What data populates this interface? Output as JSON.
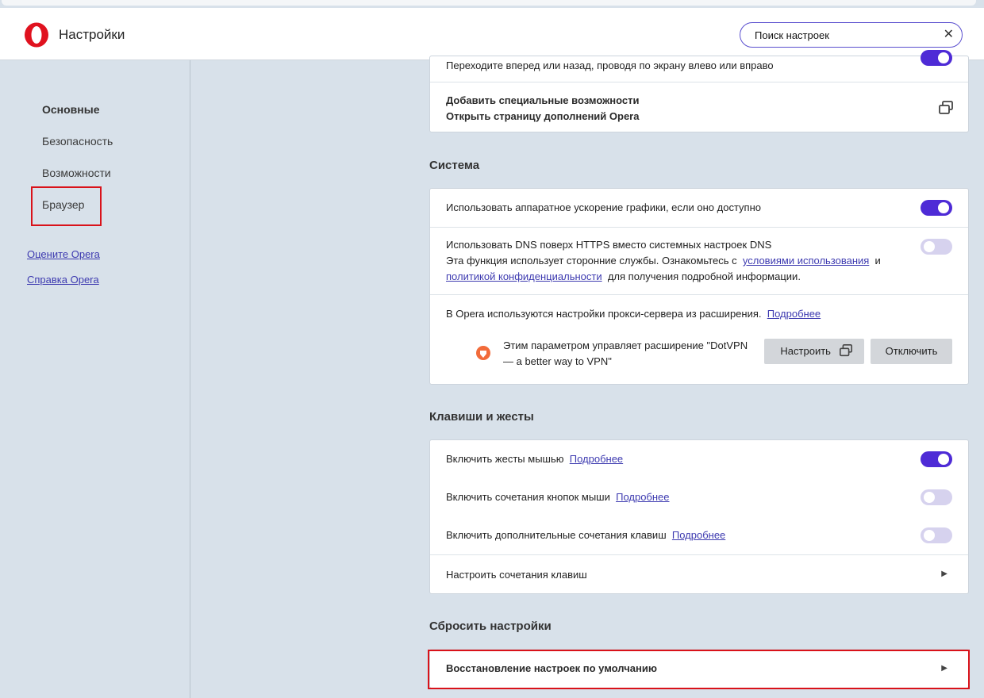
{
  "header": {
    "title": "Настройки",
    "search_value": "Поиск настроек",
    "clear_icon": "close-icon"
  },
  "sidebar": {
    "items": [
      {
        "label": "Основные"
      },
      {
        "label": "Безопасность"
      },
      {
        "label": "Возможности"
      },
      {
        "label": "Браузер"
      }
    ],
    "links": [
      {
        "label": "Оцените Opera"
      },
      {
        "label": "Справка Opera"
      }
    ]
  },
  "top_card": {
    "swipe_text": "Переходите вперед или назад, проводя по экрану влево или вправо",
    "accessibility_title": "Добавить специальные возможности",
    "accessibility_sub": "Открыть страницу дополнений Opera"
  },
  "system": {
    "title": "Система",
    "hw_accel": "Использовать аппаратное ускорение графики, если оно доступно",
    "dns_title": "Использовать DNS поверх HTTPS вместо системных настроек DNS",
    "dns_desc_1": "Эта функция использует сторонние службы. Ознакомьтесь с",
    "dns_link_terms": "условиями использования",
    "dns_and": "и",
    "dns_link_privacy": "политикой конфиденциальности",
    "dns_desc_2": "для получения подробной информации.",
    "proxy_text": "В Opera используются настройки прокси-сервера из расширения.",
    "proxy_more": "Подробнее",
    "ext_line1": "Этим параметром управляет расширение \"DotVPN",
    "ext_line2": "— a better way to VPN\"",
    "configure_btn": "Настроить",
    "disable_btn": "Отключить"
  },
  "keys": {
    "title": "Клавиши и жесты",
    "mouse_gestures": "Включить жесты мышью",
    "mouse_buttons": "Включить сочетания кнопок мыши",
    "extra_keys": "Включить дополнительные сочетания клавиш",
    "more": "Подробнее",
    "configure_keys": "Настроить сочетания клавиш"
  },
  "reset": {
    "title": "Сбросить настройки",
    "restore": "Восстановление настроек по умолчанию"
  },
  "toggles": {
    "swipe": true,
    "hw_accel": true,
    "dns": false,
    "mouse_gestures": true,
    "mouse_buttons": false,
    "extra_keys": false
  },
  "colors": {
    "accent": "#4e2bd6",
    "toggle_off": "#d6d2ee",
    "highlight": "#d9121a",
    "link": "#3d3ab0"
  }
}
